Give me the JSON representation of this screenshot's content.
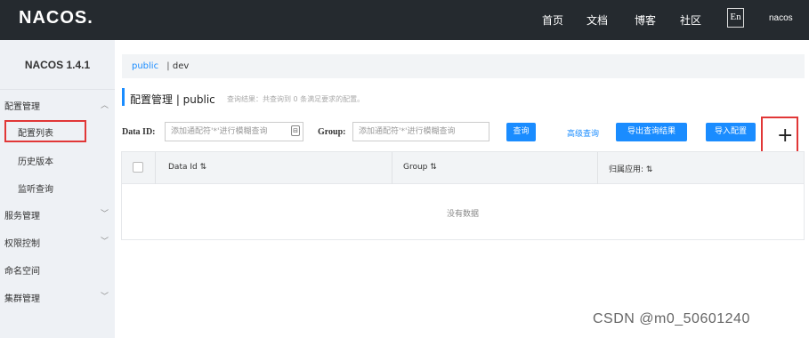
{
  "header": {
    "logo": "NACOS.",
    "nav": [
      "首页",
      "文档",
      "博客",
      "社区"
    ],
    "lang": "En",
    "user": "nacos"
  },
  "sidebar": {
    "version": "NACOS 1.4.1",
    "groups": [
      {
        "label": "配置管理",
        "expanded": true,
        "items": [
          "配置列表",
          "历史版本",
          "监听查询"
        ]
      },
      {
        "label": "服务管理"
      },
      {
        "label": "权限控制"
      },
      {
        "label": "命名空间"
      },
      {
        "label": "集群管理"
      }
    ],
    "selected": "配置列表"
  },
  "breadcrumb": {
    "active": "public",
    "sep": "|",
    "other": "dev"
  },
  "page": {
    "title": "配置管理 | public",
    "subtitle": "查询结果：共查询到 0 条满足要求的配置。"
  },
  "search": {
    "data_id_label": "Data ID:",
    "data_id_placeholder": "添加通配符'*'进行模糊查询",
    "group_label": "Group:",
    "group_placeholder": "添加通配符'*'进行模糊查询",
    "query_btn": "查询",
    "advanced": "高级查询",
    "export_btn": "导出查询结果",
    "import_btn": "导入配置",
    "add_icon": "+"
  },
  "table": {
    "columns": [
      "Data Id ⇅",
      "Group ⇅",
      "归属应用: ⇅"
    ],
    "empty_text": "没有数据"
  },
  "watermark": "CSDN @m0_50601240",
  "colors": {
    "topbar": "#252a2f",
    "accent": "#1a8cff",
    "highlight": "#e13737"
  }
}
